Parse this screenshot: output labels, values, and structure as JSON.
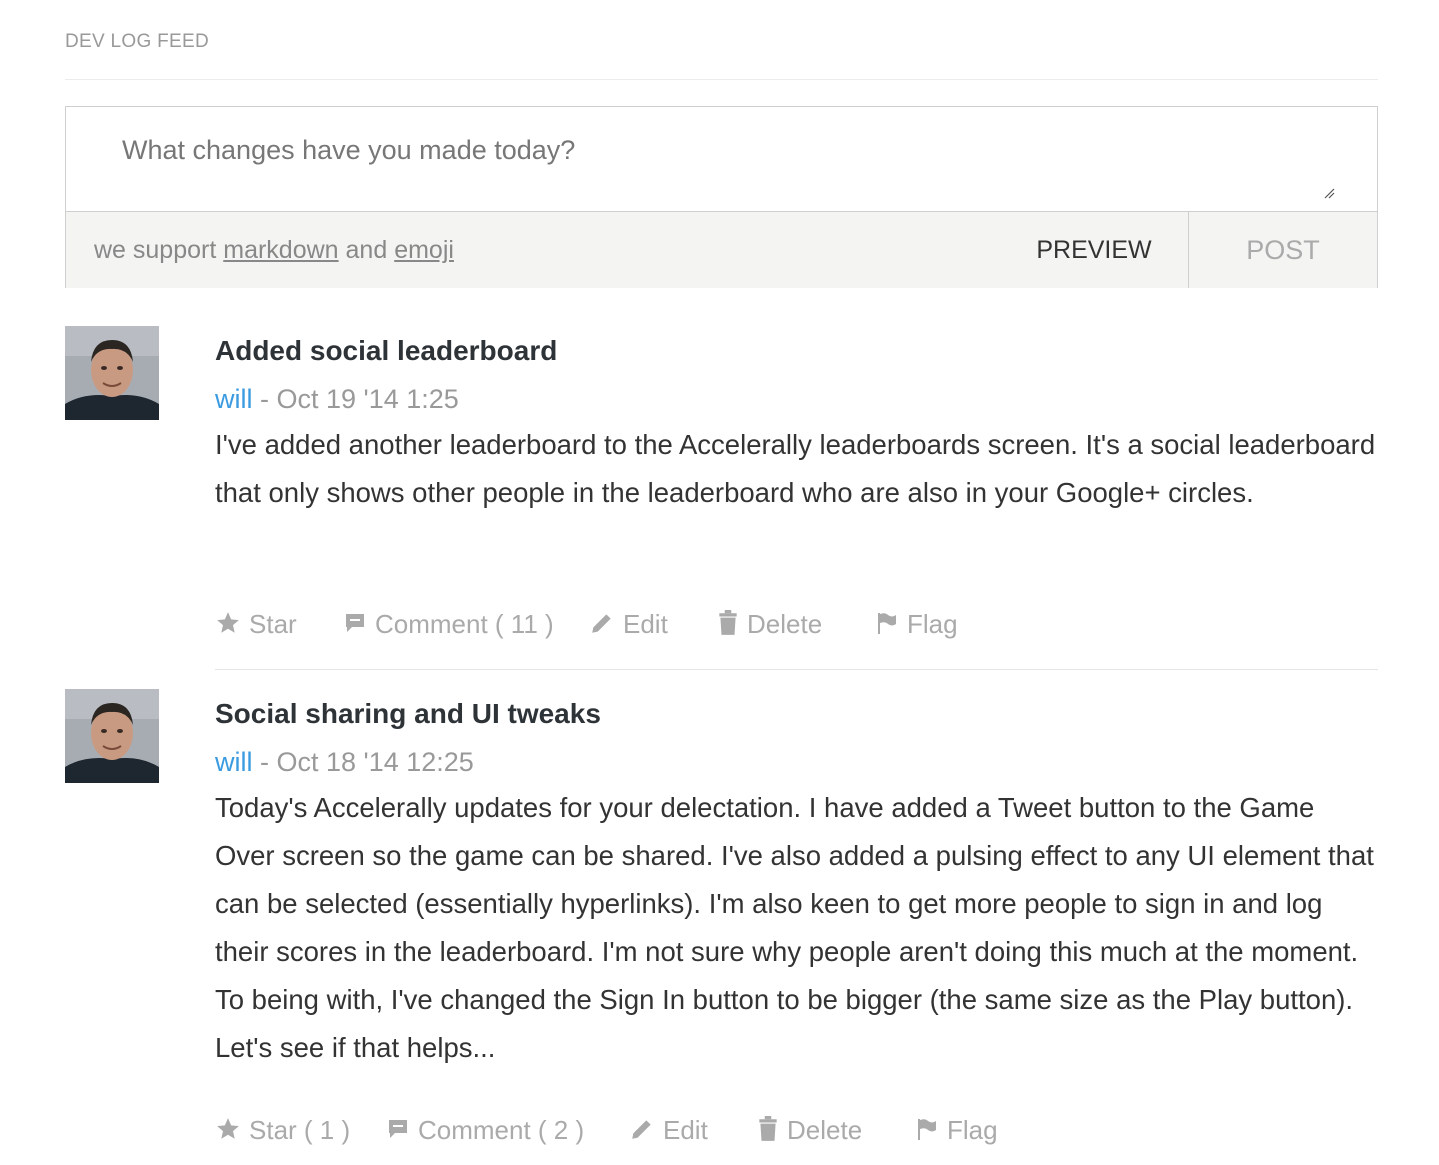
{
  "feed": {
    "title": "DEV LOG FEED"
  },
  "composer": {
    "placeholder": "What changes have you made today?",
    "support_prefix": "we support",
    "markdown_link": "markdown",
    "support_and": "and",
    "emoji_link": "emoji",
    "preview_label": "PREVIEW",
    "post_label": "POST"
  },
  "posts": [
    {
      "title": "Added social leaderboard",
      "author": "will",
      "date": "- Oct 19 '14 1:25",
      "body": "I've added another leaderboard to the Accelerally leaderboards screen. It's a social leaderboard that only shows other people in the leaderboard who are also in your Google+ circles.",
      "actions": {
        "star": "Star",
        "comment": "Comment ( 11 )",
        "edit": "Edit",
        "delete": "Delete",
        "flag": "Flag"
      }
    },
    {
      "title": "Social sharing and UI tweaks",
      "author": "will",
      "date": "- Oct 18 '14 12:25",
      "body": "Today's Accelerally updates for your delectation. I have added a Tweet button to the Game Over screen so the game can be shared. I've also added a pulsing effect to any UI element that can be selected (essentially hyperlinks). I'm also keen to get more people to sign in and log their scores in the leaderboard. I'm not sure why people aren't doing this much at the moment. To being with, I've changed the Sign In button to be bigger (the same size as the Play button). Let's see if that helps...",
      "actions": {
        "star": "Star ( 1 )",
        "comment": "Comment ( 2 )",
        "edit": "Edit",
        "delete": "Delete",
        "flag": "Flag"
      }
    }
  ],
  "colors": {
    "author_link": "#3b9be0",
    "muted": "#aaaaaa",
    "title": "#2e3338"
  }
}
